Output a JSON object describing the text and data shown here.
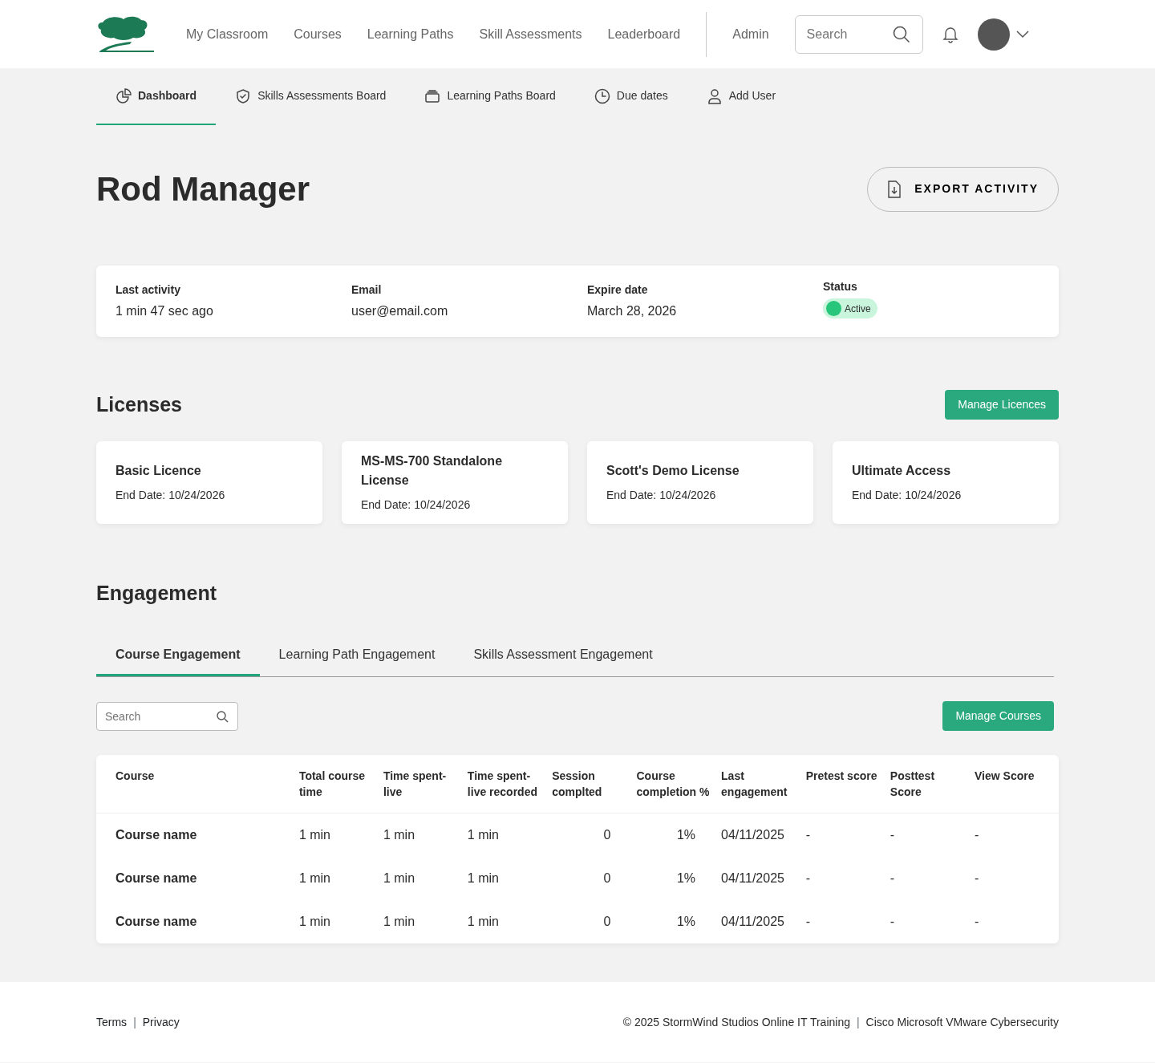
{
  "top_nav": {
    "links": [
      {
        "label": "My Classroom"
      },
      {
        "label": "Courses"
      },
      {
        "label": "Learning Paths"
      },
      {
        "label": "Skill Assessments"
      },
      {
        "label": "Leaderboard"
      }
    ],
    "admin_link": "Admin",
    "search": {
      "placeholder": "Search"
    }
  },
  "sub_nav": [
    {
      "label": "Dashboard",
      "kind": "pie",
      "selected": true
    },
    {
      "label": "Skills Assessments Board",
      "kind": "shield",
      "selected": false
    },
    {
      "label": "Learning Paths Board",
      "kind": "stack",
      "selected": false
    },
    {
      "label": "Due dates",
      "kind": "clock",
      "selected": false
    },
    {
      "label": "Add User",
      "kind": "person",
      "selected": false
    }
  ],
  "user": {
    "name": "Rod Manager",
    "export_button": "EXPORT ACTIVITY",
    "fields": [
      {
        "label": "Last activity",
        "value": "1 min 47 sec ago"
      },
      {
        "label": "Email",
        "value": "user@email.com"
      },
      {
        "label": "Expire date",
        "value": "March 28, 2026"
      }
    ],
    "status": {
      "label": "Status",
      "value": "Active"
    }
  },
  "licenses": {
    "title": "Licenses",
    "button": "Manage Licences",
    "items": [
      {
        "name": "Basic Licence",
        "end_date": "End Date: 10/24/2026"
      },
      {
        "name": "MS-MS-700 Standalone License",
        "end_date": "End Date: 10/24/2026"
      },
      {
        "name": "Scott's Demo License",
        "end_date": "End Date: 10/24/2026"
      },
      {
        "name": "Ultimate Access",
        "end_date": "End Date: 10/24/2026"
      }
    ]
  },
  "engagement": {
    "title": "Engagement",
    "tabs": [
      {
        "label": "Course Engagement",
        "selected": true
      },
      {
        "label": "Learning Path Engagement",
        "selected": false
      },
      {
        "label": "Skills Assessment Engagement",
        "selected": false
      }
    ],
    "search": {
      "placeholder": "Search"
    },
    "button": "Manage Courses",
    "table": {
      "columns": [
        "Course",
        "Total course time",
        "Time spent-live",
        "Time spent-live recorded",
        "Session complted",
        "Course completion %",
        "Last engagement",
        "Pretest score",
        "Posttest Score",
        "View Score"
      ],
      "rows": [
        [
          "Course name",
          "1 min",
          "1 min",
          "1 min",
          "0",
          "1%",
          "04/11/2025",
          "-",
          "-",
          "-"
        ],
        [
          "Course name",
          "1 min",
          "1 min",
          "1 min",
          "0",
          "1%",
          "04/11/2025",
          "-",
          "-",
          "-"
        ],
        [
          "Course name",
          "1 min",
          "1 min",
          "1 min",
          "0",
          "1%",
          "04/11/2025",
          "-",
          "-",
          "-"
        ]
      ]
    }
  },
  "footer": {
    "left": [
      "Terms",
      "Privacy"
    ],
    "separator": "|",
    "copyright": "© 2025 StormWind Studios Online IT Training",
    "tagline": "Cisco Microsoft VMware Cybersecurity"
  }
}
